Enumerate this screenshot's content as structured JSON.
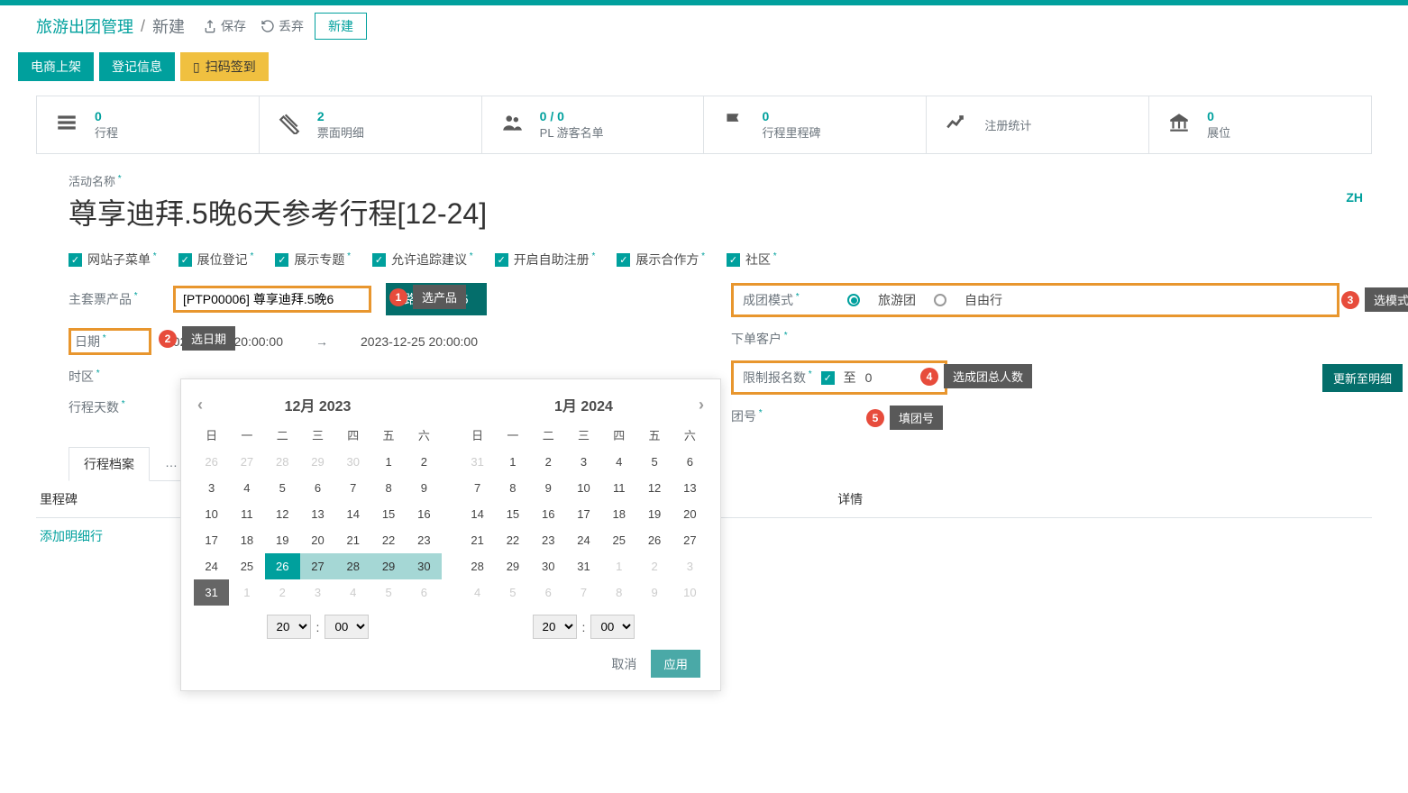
{
  "breadcrumb": {
    "parent": "旅游出团管理",
    "current": "新建"
  },
  "actions": {
    "save": "保存",
    "discard": "丢弃",
    "new": "新建"
  },
  "buttons": {
    "ecommerce": "电商上架",
    "register_info": "登记信息",
    "scan_checkin": "扫码签到"
  },
  "stats": [
    {
      "icon": "list",
      "value": "0",
      "label": "行程"
    },
    {
      "icon": "ticket",
      "value": "2",
      "label": "票面明细"
    },
    {
      "icon": "users",
      "value": "0 / 0",
      "label": "PL 游客名单"
    },
    {
      "icon": "flag",
      "value": "0",
      "label": "行程里程碑"
    },
    {
      "icon": "chart",
      "value": "",
      "label": "注册统计"
    },
    {
      "icon": "bank",
      "value": "0",
      "label": "展位"
    }
  ],
  "title_label": "活动名称",
  "title_value": "尊享迪拜.5晚6天参考行程[12-24]",
  "lang_badge": "ZH",
  "checks": [
    {
      "label": "网站子菜单"
    },
    {
      "label": "展位登记"
    },
    {
      "label": "展示专题"
    },
    {
      "label": "允许追踪建议"
    },
    {
      "label": "开启自助注册"
    },
    {
      "label": "展示合作方"
    },
    {
      "label": "社区"
    }
  ],
  "left_fields": {
    "product_label": "主套票产品",
    "product_value": "[PTP00006] 尊享迪拜.5晚6",
    "product_btn": "路   选产品   5",
    "date_label": "日期",
    "date_start": "2023-12-24 20:00:00",
    "date_end": "2023-12-25 20:00:00",
    "tz_label": "时区",
    "days_label": "行程天数"
  },
  "right_fields": {
    "mode_label": "成团模式",
    "mode_opt1": "旅游团",
    "mode_opt2": "自由行",
    "customer_label": "下单客户",
    "limit_label": "限制报名数",
    "limit_to": "至",
    "limit_val": "0",
    "update_btn": "更新至明细",
    "group_label": "团号"
  },
  "annotations": {
    "a1": "选产品",
    "a2": "选日期",
    "a3": "选模式",
    "a4": "选成团总人数",
    "a5": "填团号"
  },
  "tabs": {
    "active": "行程档案"
  },
  "grid": {
    "c1": "里程碑",
    "c2": "详情",
    "add": "添加明细行"
  },
  "calendar": {
    "month1": "12月 2023",
    "month2": "1月 2024",
    "dow": [
      "日",
      "一",
      "二",
      "三",
      "四",
      "五",
      "六"
    ],
    "m1_rows": [
      [
        {
          "d": "26",
          "m": true
        },
        {
          "d": "27",
          "m": true
        },
        {
          "d": "28",
          "m": true
        },
        {
          "d": "29",
          "m": true
        },
        {
          "d": "30",
          "m": true
        },
        {
          "d": "1"
        },
        {
          "d": "2"
        }
      ],
      [
        {
          "d": "3"
        },
        {
          "d": "4"
        },
        {
          "d": "5"
        },
        {
          "d": "6"
        },
        {
          "d": "7"
        },
        {
          "d": "8"
        },
        {
          "d": "9"
        }
      ],
      [
        {
          "d": "10"
        },
        {
          "d": "11"
        },
        {
          "d": "12"
        },
        {
          "d": "13"
        },
        {
          "d": "14"
        },
        {
          "d": "15"
        },
        {
          "d": "16"
        }
      ],
      [
        {
          "d": "17"
        },
        {
          "d": "18"
        },
        {
          "d": "19"
        },
        {
          "d": "20"
        },
        {
          "d": "21"
        },
        {
          "d": "22"
        },
        {
          "d": "23"
        }
      ],
      [
        {
          "d": "24"
        },
        {
          "d": "25"
        },
        {
          "d": "26",
          "s": "start"
        },
        {
          "d": "27",
          "s": "range"
        },
        {
          "d": "28",
          "s": "range"
        },
        {
          "d": "29",
          "s": "range"
        },
        {
          "d": "30",
          "s": "range"
        }
      ],
      [
        {
          "d": "31",
          "s": "today"
        },
        {
          "d": "1",
          "m": true
        },
        {
          "d": "2",
          "m": true
        },
        {
          "d": "3",
          "m": true
        },
        {
          "d": "4",
          "m": true
        },
        {
          "d": "5",
          "m": true
        },
        {
          "d": "6",
          "m": true
        }
      ]
    ],
    "m2_rows": [
      [
        {
          "d": "31",
          "m": true
        },
        {
          "d": "1"
        },
        {
          "d": "2"
        },
        {
          "d": "3"
        },
        {
          "d": "4"
        },
        {
          "d": "5"
        },
        {
          "d": "6"
        }
      ],
      [
        {
          "d": "7"
        },
        {
          "d": "8"
        },
        {
          "d": "9"
        },
        {
          "d": "10"
        },
        {
          "d": "11"
        },
        {
          "d": "12"
        },
        {
          "d": "13"
        }
      ],
      [
        {
          "d": "14"
        },
        {
          "d": "15"
        },
        {
          "d": "16"
        },
        {
          "d": "17"
        },
        {
          "d": "18"
        },
        {
          "d": "19"
        },
        {
          "d": "20"
        }
      ],
      [
        {
          "d": "21"
        },
        {
          "d": "22"
        },
        {
          "d": "23"
        },
        {
          "d": "24"
        },
        {
          "d": "25"
        },
        {
          "d": "26"
        },
        {
          "d": "27"
        }
      ],
      [
        {
          "d": "28"
        },
        {
          "d": "29"
        },
        {
          "d": "30"
        },
        {
          "d": "31"
        },
        {
          "d": "1",
          "m": true
        },
        {
          "d": "2",
          "m": true
        },
        {
          "d": "3",
          "m": true
        }
      ],
      [
        {
          "d": "4",
          "m": true
        },
        {
          "d": "5",
          "m": true
        },
        {
          "d": "6",
          "m": true
        },
        {
          "d": "7",
          "m": true
        },
        {
          "d": "8",
          "m": true
        },
        {
          "d": "9",
          "m": true
        },
        {
          "d": "10",
          "m": true
        }
      ]
    ],
    "hour": "20",
    "minute": "00",
    "cancel": "取消",
    "apply": "应用"
  }
}
